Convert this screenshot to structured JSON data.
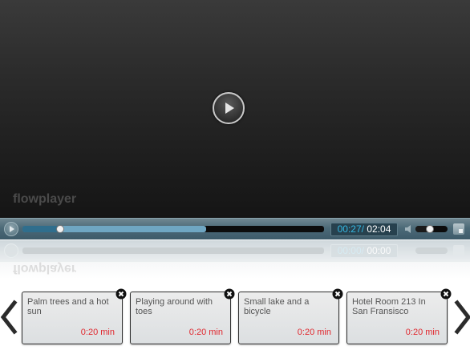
{
  "player": {
    "brand": "flowplayer",
    "time_current": "00:27",
    "time_separator": "/",
    "time_duration": "02:04",
    "progress_fraction": 0.125,
    "buffer_fraction": 0.61,
    "volume_fraction": 0.45
  },
  "reflection": {
    "time_current": "00:00",
    "time_separator": "/",
    "time_duration": "00:00"
  },
  "playlist": {
    "clips": [
      {
        "title": "Palm trees and a hot sun",
        "duration": "0:20 min"
      },
      {
        "title": "Playing around with toes",
        "duration": "0:20 min"
      },
      {
        "title": "Small lake and a bicycle",
        "duration": "0:20 min"
      },
      {
        "title": "Hotel Room 213 In San Fransisco",
        "duration": "0:20 min"
      }
    ]
  },
  "colors": {
    "time_current": "#35b6e0",
    "duration_text": "#e0262d",
    "progress": "#2f6e8d",
    "buffer": "#6fa6c2"
  },
  "icons": {
    "big_play": "play-icon",
    "control_play": "play-icon",
    "volume": "speaker-icon",
    "fullscreen": "fullscreen-icon",
    "prev": "chevron-left-icon",
    "next": "chevron-right-icon",
    "remove": "close-icon"
  }
}
